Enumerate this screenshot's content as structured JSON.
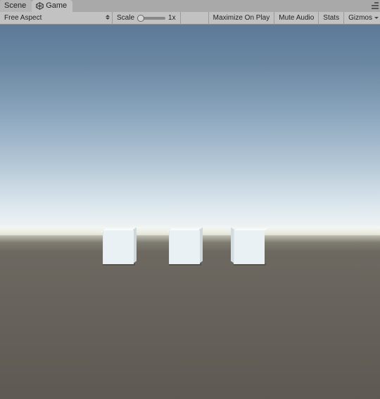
{
  "tabs": {
    "scene": "Scene",
    "game": "Game"
  },
  "toolbar": {
    "aspect": "Free Aspect",
    "scale_label": "Scale",
    "scale_value": "1x",
    "maximize": "Maximize On Play",
    "mute": "Mute Audio",
    "stats": "Stats",
    "gizmos": "Gizmos"
  }
}
